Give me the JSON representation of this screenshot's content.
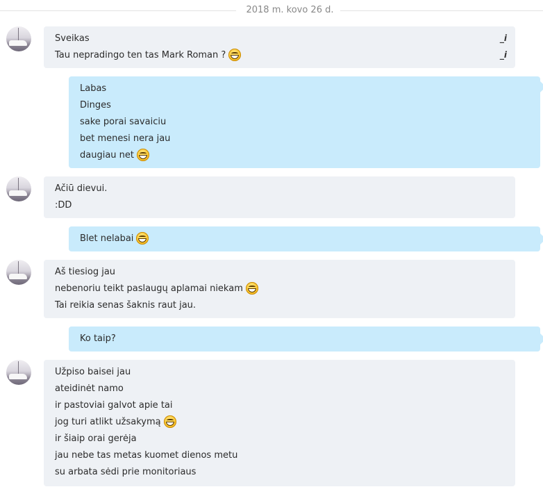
{
  "date_separator": "2018 m. kovo 26 d.",
  "edit_marker": "_i",
  "messages": [
    {
      "direction": "in",
      "lines": [
        {
          "text": "Sveikas",
          "emoji": false
        },
        {
          "text": "Tau nepradingo ten tas Mark Roman ?",
          "emoji": true
        }
      ]
    },
    {
      "direction": "out",
      "lines": [
        {
          "text": "Labas",
          "emoji": false
        },
        {
          "text": "Dinges",
          "emoji": false
        },
        {
          "text": "sake porai savaiciu",
          "emoji": false
        },
        {
          "text": "bet menesi nera jau",
          "emoji": false
        },
        {
          "text": "daugiau net",
          "emoji": true
        }
      ]
    },
    {
      "direction": "in",
      "lines": [
        {
          "text": "Ačiū dievui.",
          "emoji": false
        },
        {
          "text": ":DD",
          "emoji": false
        }
      ]
    },
    {
      "direction": "out",
      "lines": [
        {
          "text": "Blet nelabai",
          "emoji": true
        }
      ]
    },
    {
      "direction": "in",
      "lines": [
        {
          "text": "Aš tiesiog jau",
          "emoji": false
        },
        {
          "text": "nebenoriu teikt paslaugų aplamai niekam",
          "emoji": true
        },
        {
          "text": "Tai reikia senas šaknis raut jau.",
          "emoji": false
        }
      ]
    },
    {
      "direction": "out",
      "lines": [
        {
          "text": "Ko taip?",
          "emoji": false
        }
      ]
    },
    {
      "direction": "in",
      "lines": [
        {
          "text": "Užpiso baisei jau",
          "emoji": false
        },
        {
          "text": "ateidinėt namo",
          "emoji": false
        },
        {
          "text": "ir pastoviai galvot apie tai",
          "emoji": false
        },
        {
          "text": "jog turi atlikt užsakymą",
          "emoji": true
        },
        {
          "text": "ir šiaip orai gerėja",
          "emoji": false
        },
        {
          "text": "jau nebe tas metas kuomet dienos metu",
          "emoji": false
        },
        {
          "text": "su arbata sėdi prie monitoriaus",
          "emoji": false
        }
      ]
    }
  ]
}
